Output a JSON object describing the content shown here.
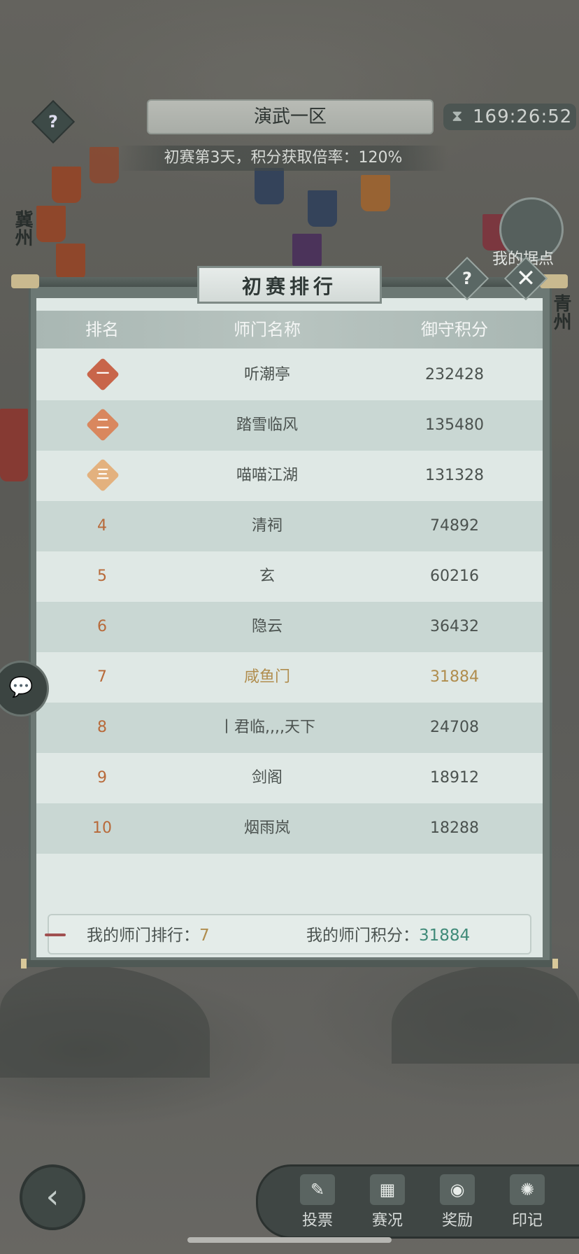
{
  "top": {
    "zone_title": "演武一区",
    "timer": "169:26:52",
    "info": "初赛第3天，积分获取倍率：120%",
    "my_base_label": "我的据点"
  },
  "map_labels": [
    "冀州",
    "青州"
  ],
  "dialog": {
    "title": "初赛排行",
    "columns": [
      "排名",
      "师门名称",
      "御守积分"
    ],
    "rows": [
      {
        "rank": "",
        "medal": "一",
        "name": "听潮亭",
        "score": "232428"
      },
      {
        "rank": "",
        "medal": "二",
        "name": "踏雪临风",
        "score": "135480"
      },
      {
        "rank": "",
        "medal": "三",
        "name": "喵喵江湖",
        "score": "131328"
      },
      {
        "rank": "4",
        "name": "清祠",
        "score": "74892"
      },
      {
        "rank": "5",
        "name": "玄",
        "score": "60216"
      },
      {
        "rank": "6",
        "name": "隐云",
        "score": "36432"
      },
      {
        "rank": "7",
        "name": "咸鱼门",
        "score": "31884"
      },
      {
        "rank": "8",
        "name": "丨君临,,,,天下",
        "score": "24708"
      },
      {
        "rank": "9",
        "name": "剑阁",
        "score": "18912"
      },
      {
        "rank": "10",
        "name": "烟雨岚",
        "score": "18288"
      }
    ],
    "my_rank_label": "我的师门排行：",
    "my_rank_value": "7",
    "my_score_label": "我的师门积分：",
    "my_score_value": "31884"
  },
  "bottom_nav": [
    {
      "label": "投票",
      "icon": "ballot-icon"
    },
    {
      "label": "赛况",
      "icon": "board-icon"
    },
    {
      "label": "奖励",
      "icon": "bag-icon"
    },
    {
      "label": "印记",
      "icon": "seal-icon"
    }
  ],
  "colors": {
    "rank_orange": "#b86a3a",
    "highlight_gold": "#b08d4e",
    "score_green": "#3f8a78",
    "medal_1": "#c8654a",
    "medal_2": "#d9875e",
    "medal_3": "#e3b17e"
  }
}
